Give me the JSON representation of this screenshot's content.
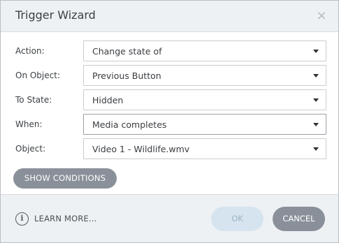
{
  "dialog": {
    "title": "Trigger Wizard",
    "close_glyph": "×"
  },
  "fields": {
    "action": {
      "label": "Action:",
      "value": "Change state of"
    },
    "on_object": {
      "label": "On Object:",
      "value": "Previous Button"
    },
    "to_state": {
      "label": "To State:",
      "value": "Hidden"
    },
    "when": {
      "label": "When:",
      "value": "Media completes"
    },
    "object": {
      "label": "Object:",
      "value": "Video 1 - Wildlife.wmv"
    }
  },
  "buttons": {
    "show_conditions": "SHOW CONDITIONS",
    "ok": "OK",
    "cancel": "CANCEL"
  },
  "footer": {
    "info_glyph": "i",
    "learn_more": "LEARN MORE..."
  },
  "colors": {
    "titlebar_bg": "#eef1f4",
    "button_gray": "#8a9099",
    "ok_disabled_bg": "#d5e4ef",
    "ok_disabled_text": "#9fb4c4"
  },
  "icons": {
    "close": "close-icon",
    "dropdown": "chevron-down-icon",
    "info": "info-icon"
  }
}
